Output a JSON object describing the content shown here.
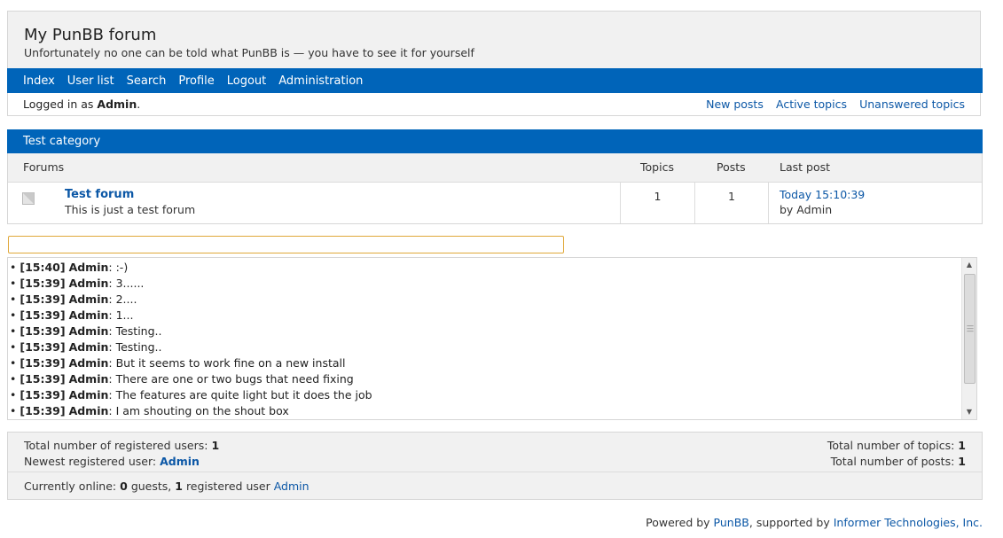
{
  "header": {
    "title": "My PunBB forum",
    "description": "Unfortunately no one can be told what PunBB is — you have to see it for yourself"
  },
  "nav": {
    "items": [
      "Index",
      "User list",
      "Search",
      "Profile",
      "Logout",
      "Administration"
    ]
  },
  "status": {
    "logged_in_prefix": "Logged in as",
    "user": "Admin",
    "suffix": ".",
    "links": [
      "New posts",
      "Active topics",
      "Unanswered topics"
    ]
  },
  "category": {
    "name": "Test category",
    "columns": {
      "forums": "Forums",
      "topics": "Topics",
      "posts": "Posts",
      "last_post": "Last post"
    },
    "forum": {
      "name": "Test forum",
      "description": "This is just a test forum",
      "topics": "1",
      "posts": "1",
      "last_post_time": "Today 15:10:39",
      "last_post_by": "by Admin"
    }
  },
  "shoutbox": {
    "input_value": "",
    "messages": [
      {
        "time": "[15:40]",
        "user": "Admin",
        "text": ": :-)"
      },
      {
        "time": "[15:39]",
        "user": "Admin",
        "text": ": 3......"
      },
      {
        "time": "[15:39]",
        "user": "Admin",
        "text": ": 2...."
      },
      {
        "time": "[15:39]",
        "user": "Admin",
        "text": ": 1..."
      },
      {
        "time": "[15:39]",
        "user": "Admin",
        "text": ": Testing.."
      },
      {
        "time": "[15:39]",
        "user": "Admin",
        "text": ": Testing.."
      },
      {
        "time": "[15:39]",
        "user": "Admin",
        "text": ": But it seems to work fine on a new install"
      },
      {
        "time": "[15:39]",
        "user": "Admin",
        "text": ": There are one or two bugs that need fixing"
      },
      {
        "time": "[15:39]",
        "user": "Admin",
        "text": ": The features are quite light but it does the job"
      },
      {
        "time": "[15:39]",
        "user": "Admin",
        "text": ": I am shouting on the shout box"
      }
    ]
  },
  "stats": {
    "registered_users_label": "Total number of registered users:",
    "registered_users": "1",
    "newest_user_label": "Newest registered user:",
    "newest_user": "Admin",
    "topics_label": "Total number of topics:",
    "topics": "1",
    "posts_label": "Total number of posts:",
    "posts": "1",
    "online_label": "Currently online:",
    "guests": "0",
    "guests_label": "guests,",
    "registered": "1",
    "registered_label": "registered user",
    "online_user": "Admin"
  },
  "footer": {
    "powered_by": "Powered by",
    "product": "PunBB",
    "supported_by": ", supported by",
    "company": "Informer Technologies, Inc."
  },
  "colors": {
    "accent": "#0064b9",
    "link": "#0b57a6",
    "panel": "#f1f1f1",
    "input_border": "#e0a83a"
  },
  "icons": {
    "forum": "forum-status-icon"
  }
}
